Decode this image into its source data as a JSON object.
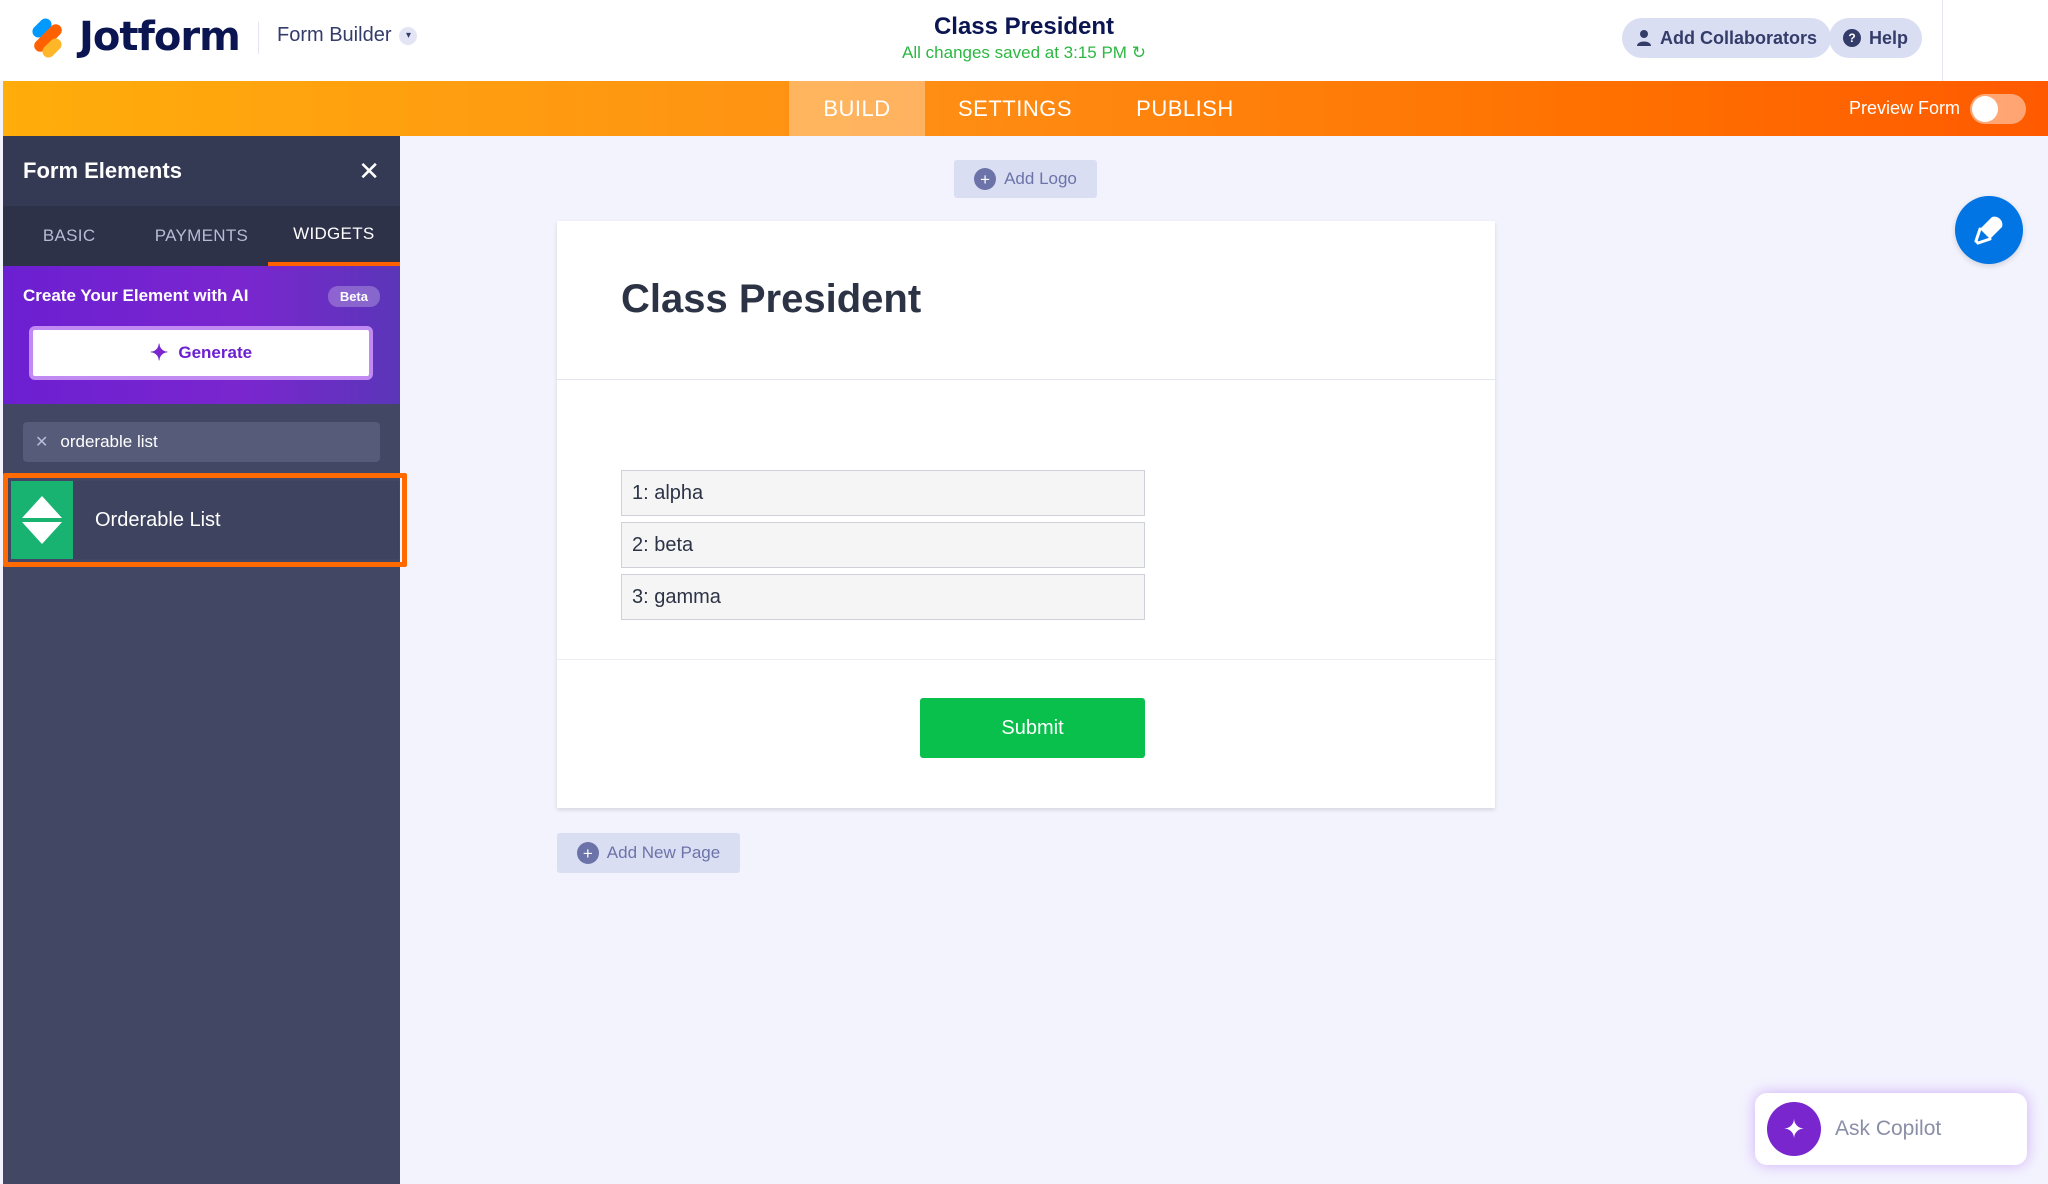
{
  "header": {
    "brand": "Jotform",
    "builder_label": "Form Builder",
    "form_title": "Class President",
    "save_status": "All changes saved at 3:15 PM",
    "collaborators_label": "Add Collaborators",
    "help_label": "Help"
  },
  "nav": {
    "tabs": [
      "BUILD",
      "SETTINGS",
      "PUBLISH"
    ],
    "active_tab": "BUILD",
    "preview_label": "Preview Form",
    "preview_on": false
  },
  "sidebar": {
    "title": "Form Elements",
    "tabs": [
      "BASIC",
      "PAYMENTS",
      "WIDGETS"
    ],
    "active_tab": "WIDGETS",
    "ai": {
      "title": "Create Your Element with AI",
      "badge": "Beta",
      "generate_label": "Generate"
    },
    "search_value": "orderable list",
    "results": [
      {
        "label": "Orderable List",
        "icon": "up-down-arrows-icon"
      }
    ]
  },
  "canvas": {
    "add_logo_label": "Add Logo",
    "form_heading": "Class President",
    "list_items": [
      "1: alpha",
      "2: beta",
      "3: gamma"
    ],
    "submit_label": "Submit",
    "add_page_label": "Add New Page"
  },
  "copilot": {
    "label": "Ask Copilot"
  },
  "colors": {
    "accent_orange": "#ff6100",
    "ai_purple": "#7a26cf",
    "submit_green": "#09c04c",
    "highlight_border": "#ff6b00",
    "status_green": "#2cb742",
    "sidebar_bg": "#424763"
  }
}
